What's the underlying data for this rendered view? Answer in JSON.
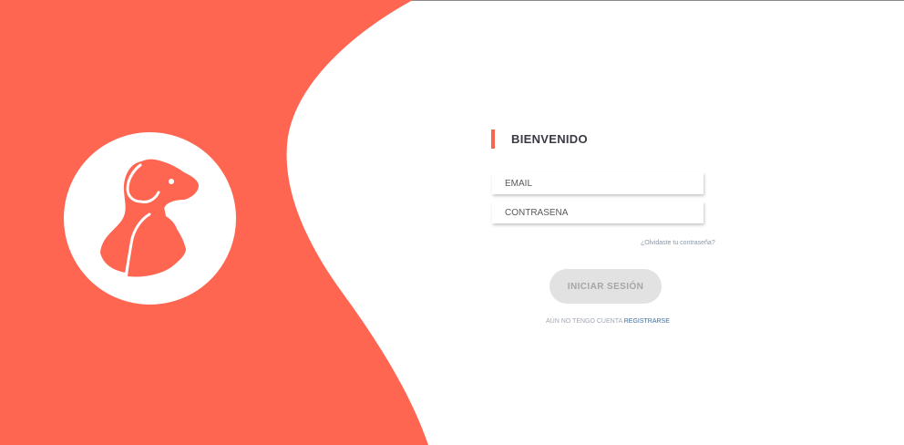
{
  "brand": {
    "logo_icon": "dog-cat-icon",
    "accent_color": "#f96650"
  },
  "login": {
    "title": "BIENVENIDO",
    "email_placeholder": "EMAIL",
    "password_placeholder": "CONTRASEÑA",
    "forgot_password_link": "¿Olvidaste tu contraseña?",
    "submit_label": "INICIAR SESIÓN",
    "no_account_text": "AÚN NO TENGO CUENTA",
    "register_link": "REGISTRARSE"
  }
}
